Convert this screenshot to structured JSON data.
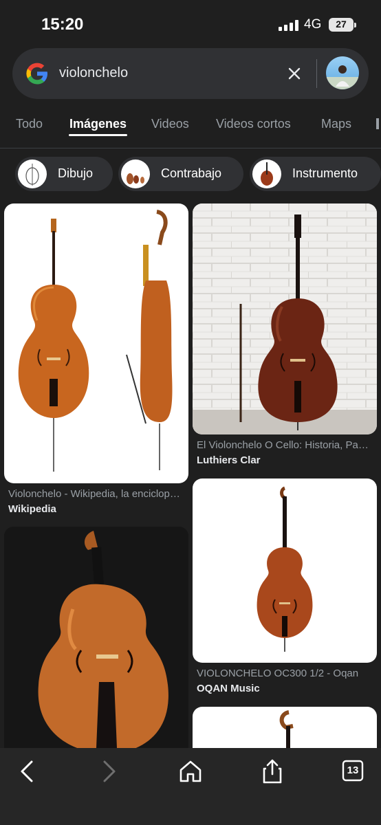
{
  "status_bar": {
    "time": "15:20",
    "network": "4G",
    "battery": "27"
  },
  "search": {
    "query": "violonchelo"
  },
  "tabs": [
    {
      "label": "Todo"
    },
    {
      "label": "Imágenes",
      "active": true
    },
    {
      "label": "Videos"
    },
    {
      "label": "Videos cortos"
    },
    {
      "label": "Maps"
    }
  ],
  "chips": [
    {
      "label": "Dibujo"
    },
    {
      "label": "Contrabajo"
    },
    {
      "label": "Instrumento"
    }
  ],
  "results": [
    {
      "title": "Violonchelo - Wikipedia, la enciclopedia libre",
      "source": "Wikipedia"
    },
    {
      "title": "El Violonchelo O Cello: Historia, Partes",
      "source": "Luthiers Clar"
    },
    {
      "title": "VIOLONCHELO OC300 1/2 - Oqan",
      "source": "OQAN Music"
    }
  ],
  "bottom_nav": {
    "tab_count": "13"
  },
  "colors": {
    "background": "#1f1f1f",
    "surface": "#303134",
    "text": "#e8eaed",
    "muted": "#9aa0a6"
  }
}
